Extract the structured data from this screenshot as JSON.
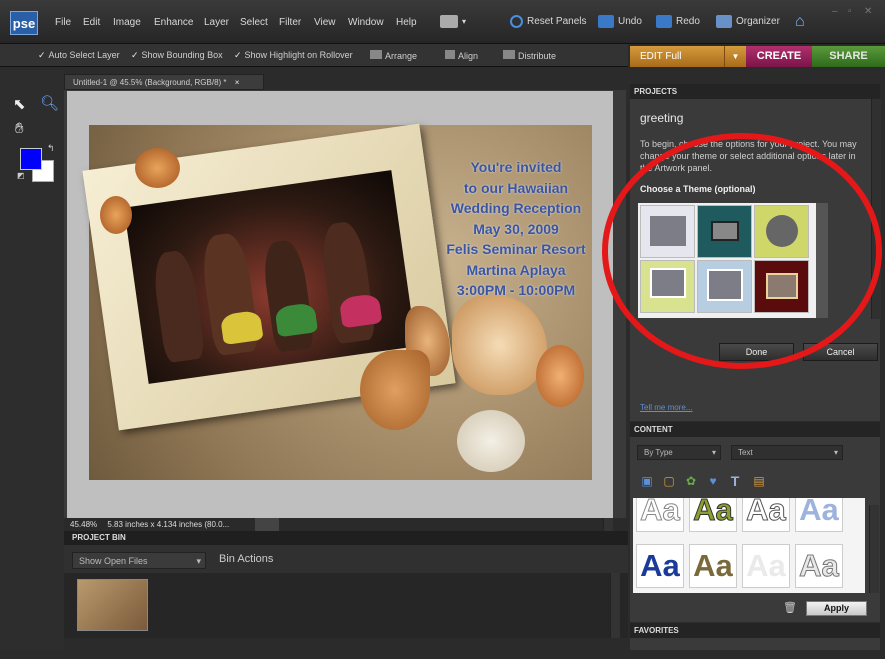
{
  "app": {
    "logo": "pse"
  },
  "menu": [
    "File",
    "Edit",
    "Image",
    "Enhance",
    "Layer",
    "Select",
    "Filter",
    "View",
    "Window",
    "Help"
  ],
  "toolbar": {
    "reset_panels": "Reset Panels",
    "undo": "Undo",
    "redo": "Redo",
    "organizer": "Organizer"
  },
  "options": {
    "auto_select": "Auto Select Layer",
    "show_bounding": "Show Bounding Box",
    "show_highlight": "Show Highlight on Rollover",
    "arrange": "Arrange",
    "align": "Align",
    "distribute": "Distribute"
  },
  "modes": {
    "edit": "EDIT Full",
    "create": "CREATE",
    "share": "SHARE"
  },
  "document": {
    "tab": "Untitled-1 @ 45.5% (Background, RGB/8) *",
    "close": "×",
    "invite_lines": [
      "You're invited",
      "to our Hawaiian",
      "Wedding Reception",
      "May 30, 2009",
      "Felis Seminar Resort",
      "Martina Aplaya",
      "3:00PM - 10:00PM"
    ]
  },
  "status": {
    "zoom": "45.48%",
    "dims": "5.83 inches x 4.134 inches (80.0..."
  },
  "bin": {
    "header": "PROJECT BIN",
    "select": "Show Open Files",
    "actions": "Bin Actions"
  },
  "projects": {
    "header": "PROJECTS",
    "title": "greeting",
    "intro": "To begin, choose the options for your project. You may change your theme or select additional options later in the Artwork panel.",
    "choose_theme": "Choose a Theme (optional)",
    "done": "Done",
    "cancel": "Cancel",
    "tell_more": "Tell me more..."
  },
  "content": {
    "header": "CONTENT",
    "filter_by": "By Type",
    "filter_type": "Text",
    "sample": "Aa",
    "apply": "Apply"
  },
  "favorites": {
    "header": "FAVORITES"
  },
  "colors": {
    "foreground": "#0000ff",
    "background": "#ffffff",
    "highlight_circle": "#e41818",
    "invite_text": "#3b55a0"
  }
}
